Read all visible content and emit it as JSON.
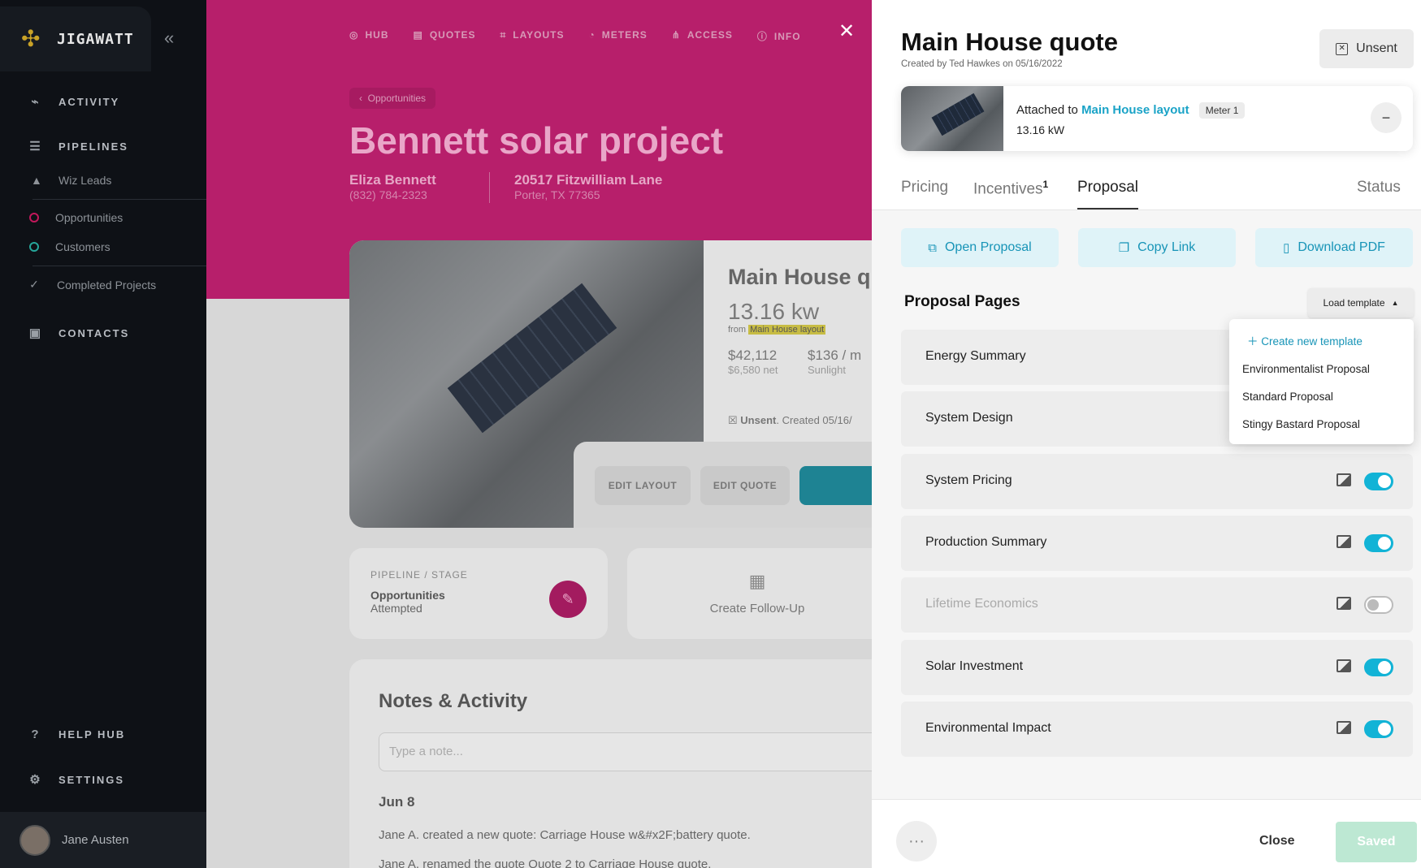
{
  "app": {
    "name": "JIGAWATT",
    "collapse_icon": "double-chevron-left-icon"
  },
  "sidebar": {
    "main": [
      {
        "label": "ACTIVITY",
        "icon": "pulse-icon"
      },
      {
        "label": "PIPELINES",
        "icon": "list-icon"
      },
      {
        "label": "CONTACTS",
        "icon": "contact-book-icon"
      }
    ],
    "sub": [
      {
        "label": "Wiz Leads",
        "icon": "wizard-hat-icon"
      },
      {
        "label": "Opportunities",
        "color": "#c2185b"
      },
      {
        "label": "Customers",
        "color": "#26a69a"
      },
      {
        "label": "Completed Projects",
        "icon": "check-icon"
      }
    ],
    "bottom": [
      {
        "label": "HELP HUB",
        "icon": "help-icon"
      },
      {
        "label": "SETTINGS",
        "icon": "gear-icon"
      }
    ],
    "user": "Jane Austen"
  },
  "background": {
    "tabs": [
      "HUB",
      "QUOTES",
      "LAYOUTS",
      "METERS",
      "ACCESS",
      "INFO"
    ],
    "breadcrumb": "Opportunities",
    "title": "Bennett solar project",
    "contact_name": "Eliza Bennett",
    "contact_phone": "(832) 784-2323",
    "address_line1": "20517 Fitzwilliam Lane",
    "address_line2": "Porter, TX 77365",
    "quote_title": "Main House q",
    "quote_kw": "13.16 kw",
    "quote_from": "from",
    "quote_layout": "Main House layout",
    "price": "$42,112",
    "price_net": "$6,580 net",
    "price2": "$136 / m",
    "price2_sub": "Sunlight",
    "status_bold": "Unsent",
    "status_rest": ". Created 05/16/",
    "btn_edit_layout": "EDIT LAYOUT",
    "btn_edit_quote": "EDIT QUOTE",
    "stage_label": "PIPELINE / STAGE",
    "stage_pipeline": "Opportunities",
    "stage_status": "Attempted",
    "follow_up": "Create Follow-Up",
    "notes_title": "Notes & Activity",
    "note_placeholder": "Type a note...",
    "note_date": "Jun 8",
    "note_entries": [
      "Jane A. created a new quote: Carriage House w&#x2F;battery quote.",
      "Jane A. renamed the quote Quote 2 to Carriage House quote."
    ]
  },
  "panel": {
    "title": "Main House quote",
    "subtitle": "Created by Ted Hawkes on 05/16/2022",
    "unsent_label": "Unsent",
    "attached_prefix": "Attached to",
    "attached_layout": "Main House layout",
    "meter": "Meter 1",
    "kw": "13.16 kW",
    "tabs": [
      {
        "label": "Pricing"
      },
      {
        "label": "Incentives",
        "badge": "1"
      },
      {
        "label": "Proposal",
        "active": true
      },
      {
        "label": "Status"
      }
    ],
    "actions": [
      {
        "label": "Open Proposal",
        "icon": "external-link-icon"
      },
      {
        "label": "Copy Link",
        "icon": "copy-icon"
      },
      {
        "label": "Download PDF",
        "icon": "pdf-file-icon"
      }
    ],
    "pages_title": "Proposal Pages",
    "load_template": "Load template",
    "dropdown": {
      "create": "Create new template",
      "items": [
        "Environmentalist Proposal",
        "Standard Proposal",
        "Stingy Bastard Proposal"
      ]
    },
    "pages": [
      {
        "label": "Energy Summary",
        "enabled": true
      },
      {
        "label": "System Design",
        "enabled": true
      },
      {
        "label": "System Pricing",
        "enabled": true
      },
      {
        "label": "Production Summary",
        "enabled": true
      },
      {
        "label": "Lifetime Economics",
        "enabled": false
      },
      {
        "label": "Solar Investment",
        "enabled": true
      },
      {
        "label": "Environmental Impact",
        "enabled": true
      }
    ],
    "more": "···",
    "close": "Close",
    "saved": "Saved"
  },
  "colors": {
    "brand_magenta": "#b71f6b",
    "accent_teal": "#12b3d6",
    "link_teal": "#1aa3c7"
  }
}
